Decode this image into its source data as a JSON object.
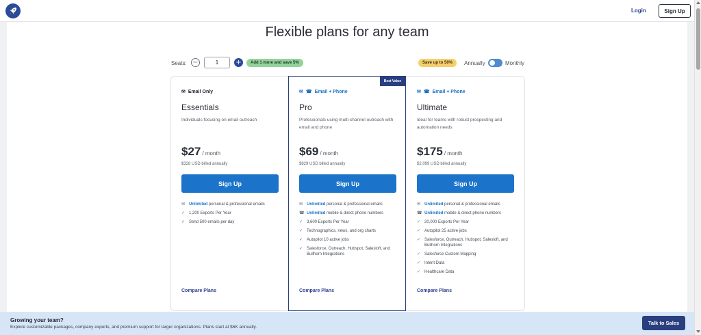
{
  "header": {
    "login_label": "Login",
    "signup_label": "Sign Up"
  },
  "page": {
    "title": "Flexible plans for any team"
  },
  "seats": {
    "label": "Seats:",
    "value": "1",
    "minus": "−",
    "plus": "+",
    "promo": "Add 1 more and save 5%"
  },
  "billing": {
    "promo": "Save up to 50%",
    "annually_label": "Annually",
    "monthly_label": "Monthly",
    "selected": "Monthly"
  },
  "plans": [
    {
      "contact_type": "Email Only",
      "name": "Essentials",
      "description": "Individuals focusing on email outreach",
      "price": "$27",
      "per": "/ month",
      "billed": "$328 USD billed annually",
      "cta": "Sign Up",
      "compare": "Compare Plans",
      "features": [
        {
          "icon": "envelope-icon",
          "highlight": "Unlimited",
          "text": " personal & professional emails"
        },
        {
          "icon": "check-icon",
          "highlight": "",
          "text": "1,200 Exports Per Year"
        },
        {
          "icon": "check-icon",
          "highlight": "",
          "text": "Send 500 emails per day"
        }
      ]
    },
    {
      "contact_type": "Email + Phone",
      "name": "Pro",
      "badge": "Best Value",
      "description": "Professionals using multi-channel outreach with email and phone",
      "price": "$69",
      "per": "/ month",
      "billed": "$829 USD billed annually",
      "cta": "Sign Up",
      "compare": "Compare Plans",
      "features": [
        {
          "icon": "envelope-icon",
          "highlight": "Unlimited",
          "text": " personal & professional emails"
        },
        {
          "icon": "phone-icon",
          "highlight": "Unlimited",
          "text": " mobile & direct phone numbers"
        },
        {
          "icon": "check-icon",
          "highlight": "",
          "text": "3,600 Exports Per Year"
        },
        {
          "icon": "check-icon",
          "highlight": "",
          "text": "Technographics, news, and org charts"
        },
        {
          "icon": "check-icon",
          "highlight": "",
          "text": "Autopilot 10 active jobs"
        },
        {
          "icon": "check-icon",
          "highlight": "",
          "text": "Salesforce, Outreach, Hubspot, Salesloft, and Bullhorn Integrations"
        }
      ]
    },
    {
      "contact_type": "Email + Phone",
      "name": "Ultimate",
      "description": "Ideal for teams with robust prospecting and automation needs",
      "price": "$175",
      "per": "/ month",
      "billed": "$2,099 USD billed annually",
      "cta": "Sign Up",
      "compare": "Compare Plans",
      "features": [
        {
          "icon": "envelope-icon",
          "highlight": "Unlimited",
          "text": " personal & professional emails"
        },
        {
          "icon": "phone-icon",
          "highlight": "Unlimited",
          "text": " mobile & direct phone numbers"
        },
        {
          "icon": "check-icon",
          "highlight": "",
          "text": "20,000 Exports Per Year"
        },
        {
          "icon": "check-icon",
          "highlight": "",
          "text": "Autopilot 25 active jobs"
        },
        {
          "icon": "check-icon",
          "highlight": "",
          "text": "Salesforce, Outreach, Hubspot, Salesloft, and Bullhorn Integrations"
        },
        {
          "icon": "check-icon",
          "highlight": "",
          "text": "Salesforce Custom Mapping"
        },
        {
          "icon": "check-icon",
          "highlight": "",
          "text": "Intent Data"
        },
        {
          "icon": "check-icon",
          "highlight": "",
          "text": "Healthcare Data"
        }
      ]
    }
  ],
  "banner": {
    "title": "Growing your team?",
    "subtitle": "Explore customizable packages, company exports, and premium support for larger organizations. Plans start at $6K annually.",
    "cta": "Talk to Sales"
  },
  "colors": {
    "primary": "#1b74c9",
    "navy": "#2a3f7f",
    "banner_bg": "#d7e6f6",
    "green_pill": "#93d39b",
    "yellow_pill": "#f4cf6b"
  }
}
